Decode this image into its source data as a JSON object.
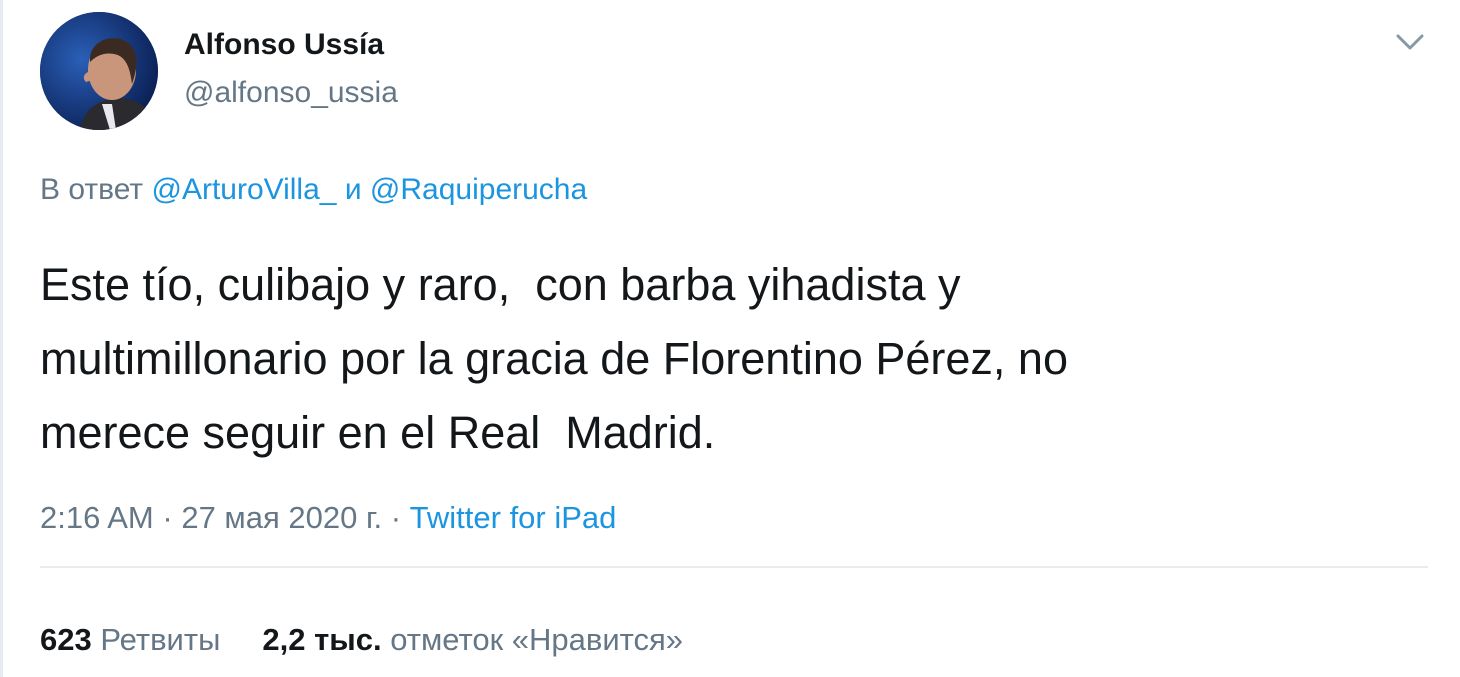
{
  "author": {
    "name": "Alfonso Ussía",
    "handle": "@alfonso_ussia"
  },
  "reply": {
    "prefix": "В ответ",
    "mention_1": "@ArturoVilla_",
    "conjunction": "и",
    "mention_2": "@Raquiperucha"
  },
  "tweet": {
    "lines": [
      "Este tío, culibajo y raro,  con barba yihadista y",
      "multimillonario por la gracia de Florentino Pérez, no",
      "merece seguir en el Real  Madrid."
    ]
  },
  "meta": {
    "time": "2:16 AM",
    "separator": "·",
    "date": "27 мая 2020 г.",
    "source": "Twitter for iPad"
  },
  "stats": {
    "retweets_count": "623",
    "retweets_label": "Ретвиты",
    "likes_count": "2,2 тыс.",
    "likes_label": "отметок «Нравится»"
  },
  "icons": {
    "menu": "chevron-down-icon",
    "avatar": "profile-photo"
  },
  "colors": {
    "text": "#14171a",
    "secondary": "#657786",
    "link": "#1b95e0",
    "divider": "#e6ecf0"
  }
}
